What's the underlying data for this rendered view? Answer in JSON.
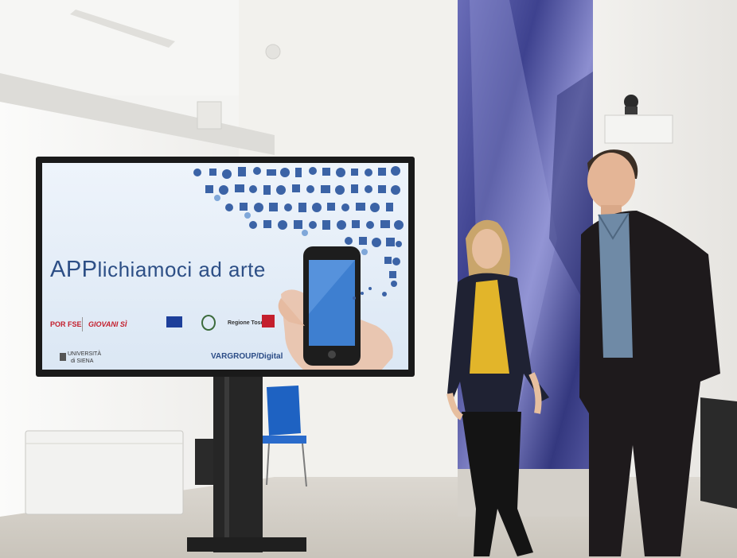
{
  "screen": {
    "title_prefix": "APP",
    "title_rest": "lichiamoci ad arte",
    "logos": {
      "por_fse": "POR FSE",
      "giovani_si": "GIOVANI SÌ",
      "regione": "Regione Toscana",
      "universita": "UNIVERSITÀ",
      "siena": "di SIENA",
      "vargroup": "VARGROUP/Digital"
    }
  },
  "colors": {
    "screen_bg": "#dfeaf5",
    "title": "#2d4f86",
    "icons": "#3b63a6",
    "phone_screen": "#3e7fd0",
    "curtain": "#4a4e9a",
    "blouse": "#e2b52a"
  }
}
